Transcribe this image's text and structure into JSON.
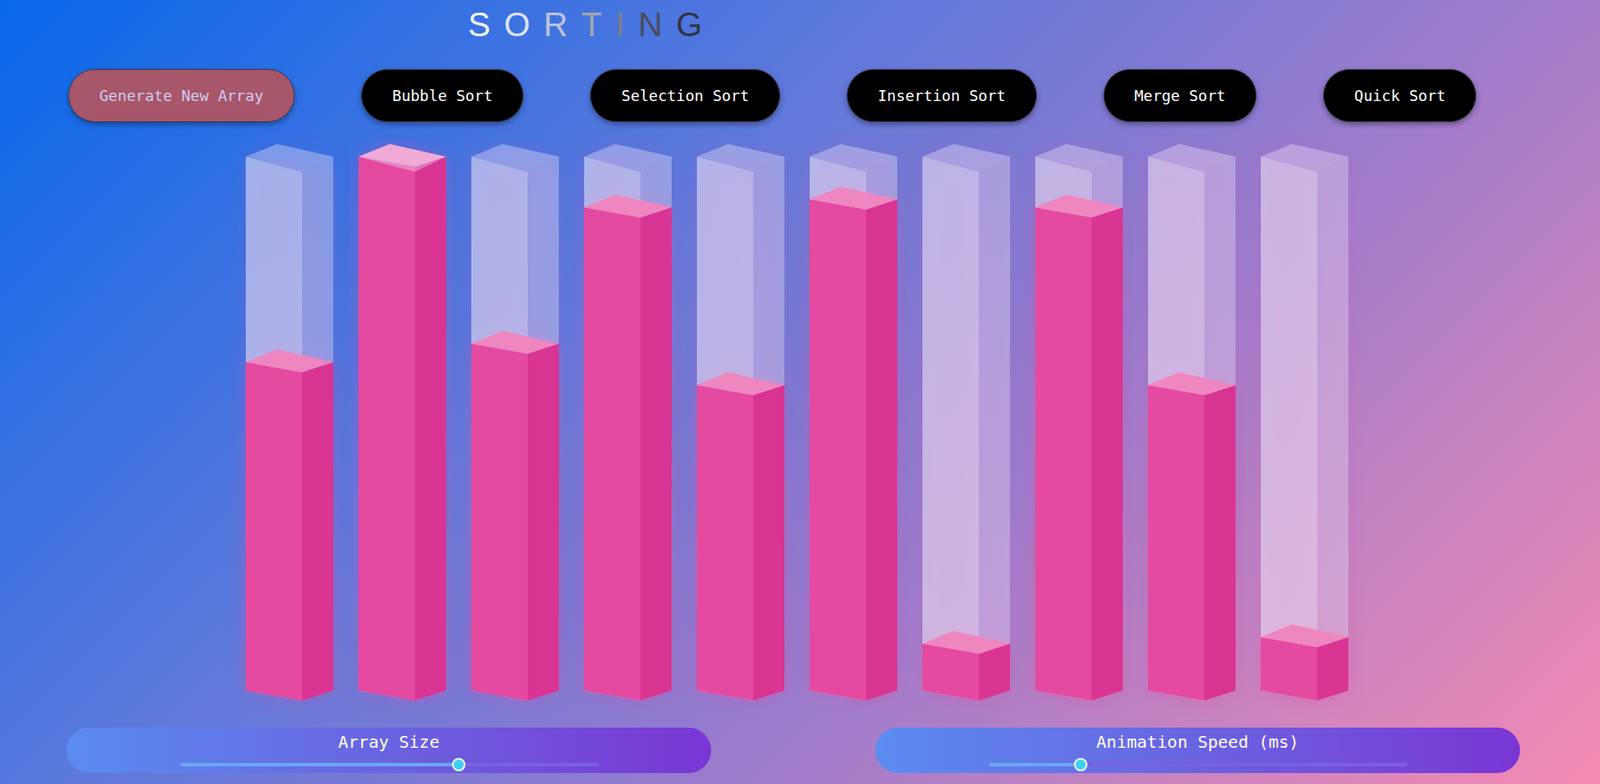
{
  "title": "SORTING",
  "buttons": [
    {
      "label": "Generate New Array",
      "kind": "generate"
    },
    {
      "label": "Bubble Sort",
      "kind": "algorithm"
    },
    {
      "label": "Selection Sort",
      "kind": "algorithm"
    },
    {
      "label": "Insertion Sort",
      "kind": "algorithm"
    },
    {
      "label": "Merge Sort",
      "kind": "algorithm"
    },
    {
      "label": "Quick Sort",
      "kind": "algorithm"
    }
  ],
  "bars": [
    {
      "level": 0.615
    },
    {
      "level": 1.0
    },
    {
      "level": 0.65
    },
    {
      "level": 0.905
    },
    {
      "level": 0.572
    },
    {
      "level": 0.92
    },
    {
      "level": 0.088
    },
    {
      "level": 0.905
    },
    {
      "level": 0.572
    },
    {
      "level": 0.1
    }
  ],
  "sliders": [
    {
      "label": "Array Size",
      "level": 0.666
    },
    {
      "label": "Animation Speed (ms)",
      "level": 0.22
    }
  ]
}
